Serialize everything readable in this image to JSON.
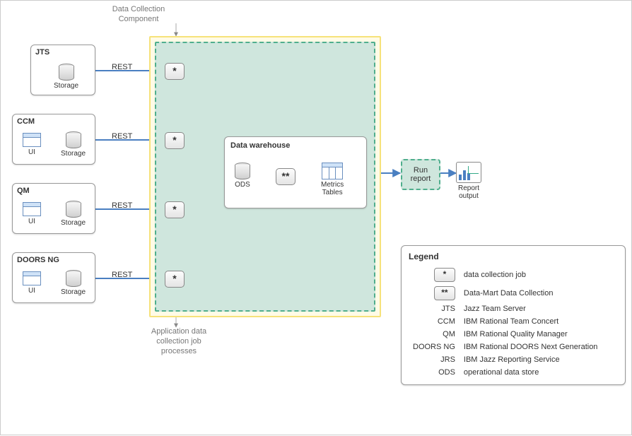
{
  "header": {
    "label": "Data Collection\nComponent"
  },
  "sources": [
    {
      "id": "jts",
      "title": "JTS",
      "has_ui": false,
      "storage": "Storage",
      "conn": "REST"
    },
    {
      "id": "ccm",
      "title": "CCM",
      "has_ui": true,
      "ui": "UI",
      "storage": "Storage",
      "conn": "REST"
    },
    {
      "id": "qm",
      "title": "QM",
      "has_ui": true,
      "ui": "UI",
      "storage": "Storage",
      "conn": "REST"
    },
    {
      "id": "doors",
      "title": "DOORS NG",
      "has_ui": true,
      "ui": "UI",
      "storage": "Storage",
      "conn": "REST"
    }
  ],
  "jobs": {
    "asterisk_single": "*",
    "asterisk_double": "**"
  },
  "dw": {
    "title": "Data warehouse",
    "ods": "ODS",
    "metrics": "Metrics\nTables"
  },
  "run": {
    "label": "Run\nreport"
  },
  "output": {
    "label": "Report\noutput"
  },
  "footer_note": "Application data\ncollection job\nprocesses",
  "legend": {
    "title": "Legend",
    "rows": [
      {
        "key_chip": "*",
        "desc": "data collection job"
      },
      {
        "key_chip": "**",
        "desc": "Data-Mart Data Collection"
      },
      {
        "key": "JTS",
        "desc": "Jazz Team Server"
      },
      {
        "key": "CCM",
        "desc": "IBM Rational Team Concert"
      },
      {
        "key": "QM",
        "desc": "IBM Rational Quality Manager"
      },
      {
        "key": "DOORS NG",
        "desc": "IBM Rational DOORS Next Generation"
      },
      {
        "key": "JRS",
        "desc": "IBM Jazz Reporting Service"
      },
      {
        "key": "ODS",
        "desc": "operational data store"
      }
    ]
  }
}
